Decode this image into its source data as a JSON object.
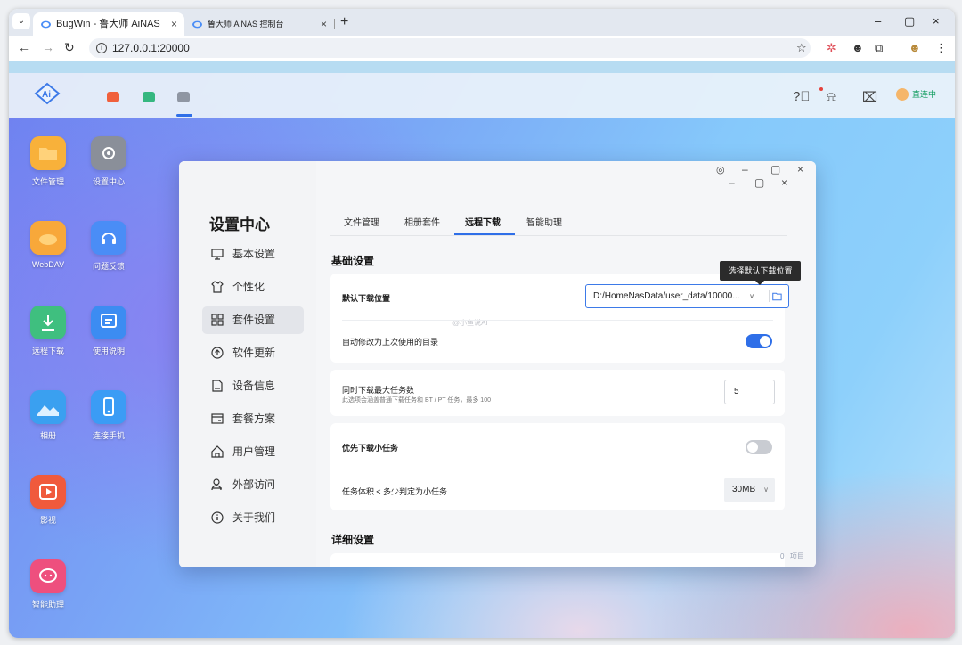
{
  "browser": {
    "tabs": [
      {
        "title": "BugWin - 鲁大师 AiNAS",
        "active": true
      },
      {
        "title": "鲁大师 AiNAS 控制台",
        "active": false
      }
    ],
    "new_tab_symbol": "+",
    "close_symbol": "×",
    "url": "127.0.0.1:20000",
    "window_controls": [
      "–",
      "▢",
      "×"
    ]
  },
  "nas": {
    "logo_text": "Ai",
    "status_text": "直连中",
    "status_color": "#0d9b5c",
    "header_icons": [
      "help-icon",
      "bell-icon",
      "inbox-icon",
      "avatar"
    ]
  },
  "desktop": {
    "apps": [
      {
        "label": "文件管理",
        "icon": "folder-icon",
        "color": "#f8b13a"
      },
      {
        "label": "设置中心",
        "icon": "gear-icon",
        "color": "#8a8f99"
      },
      {
        "label": "WebDAV",
        "icon": "cloud-icon",
        "color": "#f8a83a"
      },
      {
        "label": "问题反馈",
        "icon": "headset-icon",
        "color": "#4a8df6"
      },
      {
        "label": "远程下载",
        "icon": "download-icon",
        "color": "#3fbf7f"
      },
      {
        "label": "使用说明",
        "icon": "manual-icon",
        "color": "#3c8cf2"
      },
      {
        "label": "相册",
        "icon": "photo-icon",
        "color": "#3aa0f0"
      },
      {
        "label": "连接手机",
        "icon": "phone-icon",
        "color": "#3b9cf5"
      },
      {
        "label": "影视",
        "icon": "play-icon",
        "color": "#f05a3c"
      },
      {
        "label": "智能助理",
        "icon": "chat-icon",
        "color": "#ee4f7e"
      }
    ]
  },
  "settings": {
    "title": "设置中心",
    "menu": [
      {
        "label": "基本设置",
        "icon": "monitor-icon"
      },
      {
        "label": "个性化",
        "icon": "shirt-icon"
      },
      {
        "label": "套件设置",
        "icon": "grid-icon",
        "active": true
      },
      {
        "label": "软件更新",
        "icon": "update-icon"
      },
      {
        "label": "设备信息",
        "icon": "device-icon"
      },
      {
        "label": "套餐方案",
        "icon": "plan-icon"
      },
      {
        "label": "用户管理",
        "icon": "home-icon"
      },
      {
        "label": "外部访问",
        "icon": "users-icon"
      },
      {
        "label": "关于我们",
        "icon": "info-icon"
      }
    ],
    "tabs": [
      "文件管理",
      "相册套件",
      "远程下载",
      "智能助理"
    ],
    "active_tab": "远程下载",
    "section_basic": "基础设置",
    "section_detail": "详细设置",
    "default_path_label": "默认下载位置",
    "default_path_value": "D:/HomeNasData/user_data/10000...",
    "tooltip": "选择默认下载位置",
    "auto_dir_label": "自动修改为上次使用的目录",
    "auto_dir_on": true,
    "max_tasks_label": "同时下载最大任务数",
    "max_tasks_sub": "此选项会涵盖普通下载任务和 BT / PT 任务，最多 100",
    "max_tasks_value": "5",
    "small_first_label": "优先下载小任务",
    "small_first_on": false,
    "small_size_label": "任务体积 ≤ 多少判定为小任务",
    "small_size_value": "30MB",
    "toggle_on_color": "#2f6fe8",
    "toggle_off_color": "#c9ccd2",
    "bottom_hint": "0 | 项目"
  }
}
